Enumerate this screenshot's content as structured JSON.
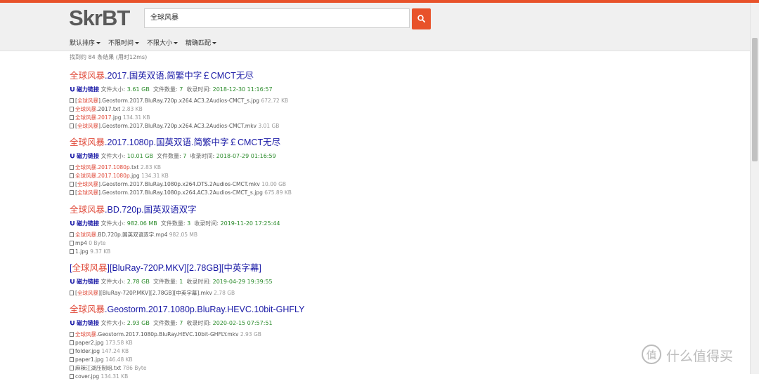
{
  "header": {
    "logo": "SkrBT",
    "search_value": "全球风暴"
  },
  "filters": [
    {
      "label": "默认排序"
    },
    {
      "label": "不限时间"
    },
    {
      "label": "不限大小"
    },
    {
      "label": "精确匹配"
    }
  ],
  "result_count": "找到约 84 条结果 (用时12ms)",
  "labels": {
    "magnet": "磁力链接",
    "size_prefix": "文件大小: ",
    "count_prefix": "文件数量: ",
    "time_prefix": "收录时间: "
  },
  "results": [
    {
      "title_hl": "全球风暴",
      "title_rest": ".2017.国英双语.简繁中字￡CMCT无尽",
      "size": "3.61 GB",
      "file_count": "7",
      "time": "2018-12-30 11:16:57",
      "files": [
        {
          "pre": "[",
          "hl": "全球风暴",
          "post": "].Geostorm.2017.BluRay.720p.x264.AC3.2Audios-CMCT_s.jpg",
          "size": "672.72 KB"
        },
        {
          "pre": "",
          "hl": "全球风暴",
          "post": ".2017.txt",
          "size": "2.83 KB"
        },
        {
          "pre": "",
          "hl": "全球风暴.2017",
          "post": ".jpg",
          "size": "134.31 KB"
        },
        {
          "pre": "[",
          "hl": "全球风暴",
          "post": "].Geostorm.2017.BluRay.720p.x264.AC3.2Audios-CMCT.mkv",
          "size": "3.01 GB"
        }
      ]
    },
    {
      "title_hl": "全球风暴",
      "title_rest": ".2017.1080p.国英双语.简繁中字￡CMCT无尽",
      "size": "10.01 GB",
      "file_count": "7",
      "time": "2018-07-29 01:16:59",
      "files": [
        {
          "pre": "",
          "hl": "全球风暴.2017.1080p",
          "post": ".txt",
          "size": "2.83 KB"
        },
        {
          "pre": "",
          "hl": "全球风暴.2017.1080p",
          "post": ".jpg",
          "size": "134.31 KB"
        },
        {
          "pre": "[",
          "hl": "全球风暴",
          "post": "].Geostorm.2017.BluRay.1080p.x264.DTS.2Audios-CMCT.mkv",
          "size": "10.00 GB"
        },
        {
          "pre": "[",
          "hl": "全球风暴",
          "post": "].Geostorm.2017.BluRay.1080p.x264.AC3.2Audios-CMCT_s.jpg",
          "size": "675.89 KB"
        }
      ]
    },
    {
      "title_hl": "全球风暴",
      "title_rest": ".BD.720p.国英双语双字",
      "size": "982.06 MB",
      "file_count": "3",
      "time": "2019-11-20 17:25:44",
      "files": [
        {
          "pre": "",
          "hl": "全球风暴",
          "post": ".BD.720p.国英双语双字.mp4",
          "size": "982.05 MB"
        },
        {
          "pre": "",
          "hl": "",
          "post": "mp4",
          "size": "0 Byte"
        },
        {
          "pre": "",
          "hl": "",
          "post": "1.jpg",
          "size": "9.37 KB"
        }
      ]
    },
    {
      "title_pre": "[",
      "title_hl": "全球风暴",
      "title_rest": "][BluRay-720P.MKV][2.78GB][中英字幕]",
      "size": "2.78 GB",
      "file_count": "1",
      "time": "2019-04-29 19:39:55",
      "files": [
        {
          "pre": "[",
          "hl": "全球风暴",
          "post": "][BluRay-720P.MKV][2.78GB][中英字幕].mkv",
          "size": "2.78 GB"
        }
      ]
    },
    {
      "title_hl": "全球风暴",
      "title_rest": ".Geostorm.2017.1080p.BluRay.HEVC.10bit-GHFLY",
      "size": "2.93 GB",
      "file_count": "7",
      "time": "2020-02-15 07:57:51",
      "files": [
        {
          "pre": "",
          "hl": "全球风暴",
          "post": ".Geostorm.2017.1080p.BluRay.HEVC.10bit-GHFLY.mkv",
          "size": "2.93 GB"
        },
        {
          "pre": "",
          "hl": "",
          "post": "paper2.jpg",
          "size": "173.58 KB"
        },
        {
          "pre": "",
          "hl": "",
          "post": "folder.jpg",
          "size": "147.24 KB"
        },
        {
          "pre": "",
          "hl": "",
          "post": "paper1.jpg",
          "size": "146.48 KB"
        },
        {
          "pre": "",
          "hl": "",
          "post": "麻辣江湖压制组.txt",
          "size": "786 Byte"
        },
        {
          "pre": "",
          "hl": "",
          "post": "cover.jpg",
          "size": "134.31 KB"
        }
      ]
    }
  ],
  "watermark": "什么值得买",
  "colors": {
    "accent": "#e8522a",
    "link": "#1a1aa6",
    "highlight": "#e04a3a",
    "green": "#2a8a2a"
  }
}
